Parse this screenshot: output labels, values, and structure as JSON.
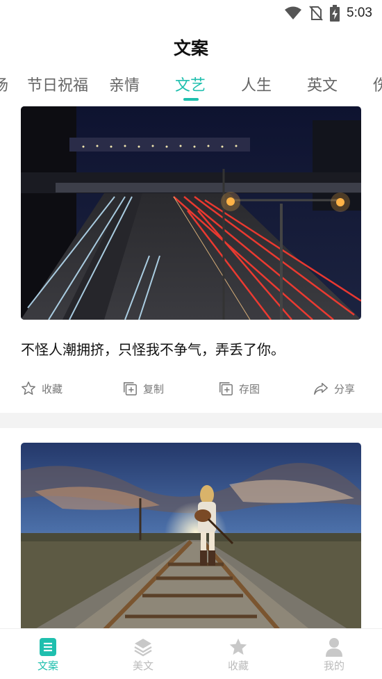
{
  "status_bar": {
    "time": "5:03",
    "icons": [
      "wifi-icon",
      "no-sim-icon",
      "battery-charging-icon"
    ]
  },
  "header": {
    "title": "文案"
  },
  "tabs": [
    {
      "label": "场",
      "active": false
    },
    {
      "label": "节日祝福",
      "active": false
    },
    {
      "label": "亲情",
      "active": false
    },
    {
      "label": "文艺",
      "active": true
    },
    {
      "label": "人生",
      "active": false
    },
    {
      "label": "英文",
      "active": false
    },
    {
      "label": "伤",
      "active": false
    }
  ],
  "cards": [
    {
      "image": "night-highway-light-trails-photo",
      "text": "不怪人潮拥挤，只怪我不争气，弄丢了你。",
      "actions": [
        {
          "icon": "star-outline-icon",
          "label": "收藏"
        },
        {
          "icon": "copy-icon",
          "label": "复制"
        },
        {
          "icon": "save-image-icon",
          "label": "存图"
        },
        {
          "icon": "share-icon",
          "label": "分享"
        }
      ]
    },
    {
      "image": "girl-with-guitar-on-railway-photo"
    }
  ],
  "bottom_nav": [
    {
      "icon": "document-icon",
      "label": "文案",
      "active": true
    },
    {
      "icon": "layers-icon",
      "label": "美文",
      "active": false
    },
    {
      "icon": "star-icon",
      "label": "收藏",
      "active": false
    },
    {
      "icon": "person-icon",
      "label": "我的",
      "active": false
    }
  ],
  "colors": {
    "accent": "#1fbfae",
    "inactive_tab": "#666666",
    "nav_inactive": "#bbbbbb",
    "divider": "#f3f3f3"
  }
}
